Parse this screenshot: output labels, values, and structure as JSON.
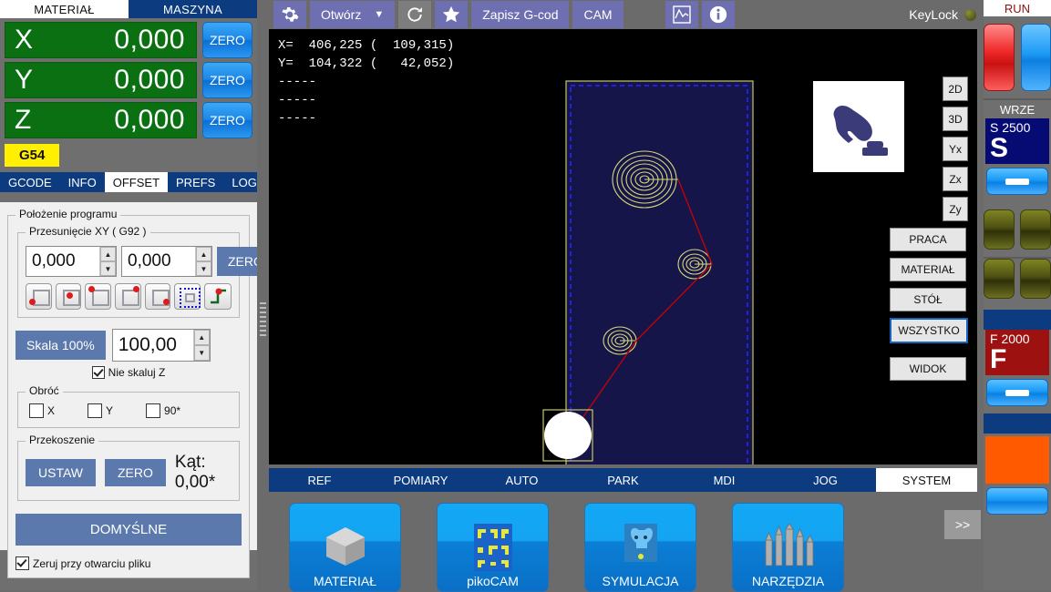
{
  "left": {
    "top_tabs": [
      {
        "label": "MATERIAŁ",
        "active": true
      },
      {
        "label": "MASZYNA",
        "active": false
      }
    ],
    "dro": [
      {
        "axis": "X",
        "value": "0,000",
        "zero_label": "ZERO"
      },
      {
        "axis": "Y",
        "value": "0,000",
        "zero_label": "ZERO"
      },
      {
        "axis": "Z",
        "value": "0,000",
        "zero_label": "ZERO"
      }
    ],
    "wcs": "G54",
    "tabs": [
      {
        "label": "GCODE",
        "active": false
      },
      {
        "label": "INFO",
        "active": false
      },
      {
        "label": "OFFSET",
        "active": true
      },
      {
        "label": "PREFS",
        "active": false
      },
      {
        "label": "LOG",
        "active": false
      }
    ],
    "offset": {
      "group_title": "Położenie programu",
      "xy_group_title": "Przesunięcie XY ( G92 )",
      "x_value": "0,000",
      "y_value": "0,000",
      "zero_label": "ZERO",
      "scale_button": "Skala 100%",
      "scale_value": "100,00",
      "no_scale_z": "Nie skaluj Z",
      "no_scale_z_checked": true,
      "rotate_title": "Obróć",
      "rotate_x": "X",
      "rotate_y": "Y",
      "rotate_90": "90*",
      "skew_title": "Przekoszenie",
      "skew_set": "USTAW",
      "skew_zero": "ZERO",
      "skew_angle": "Kąt: 0,00*",
      "defaults": "DOMYŚLNE",
      "zero_on_open": "Zeruj przy otwarciu pliku",
      "zero_on_open_checked": true
    }
  },
  "toolbar": {
    "settings_icon": "gear-icon",
    "open_label": "Otwórz",
    "open_caret": "▼",
    "reload_icon": "reload-icon",
    "favorite_icon": "star-icon",
    "save_gcode": "Zapisz G-cod",
    "cam": "CAM",
    "chart_icon": "chart-icon",
    "info_icon": "info-icon",
    "keylock": "KeyLock"
  },
  "viewport": {
    "readout": "X=  406,225 (  109,315)\nY=  104,322 (   42,052)\n-----\n-----\n-----",
    "projection_buttons": [
      "2D",
      "3D",
      "Yx",
      "Zx",
      "Zy"
    ],
    "view_buttons": [
      {
        "label": "PRACA",
        "selected": false
      },
      {
        "label": "MATERIAŁ",
        "selected": false
      },
      {
        "label": "STÓŁ",
        "selected": false
      },
      {
        "label": "WSZYSTKO",
        "selected": true
      },
      {
        "label": "WIDOK",
        "selected": false
      }
    ],
    "hand_icon": "hand-pointer-icon"
  },
  "bottom_tabs": [
    {
      "label": "REF",
      "active": false
    },
    {
      "label": "POMIARY",
      "active": false
    },
    {
      "label": "AUTO",
      "active": false
    },
    {
      "label": "PARK",
      "active": false
    },
    {
      "label": "MDI",
      "active": false
    },
    {
      "label": "JOG",
      "active": false
    },
    {
      "label": "SYSTEM",
      "active": true
    }
  ],
  "tiles": [
    {
      "label": "MATERIAŁ",
      "icon": "cube-icon"
    },
    {
      "label": "pikoCAM",
      "icon": "pikocam-icon"
    },
    {
      "label": "SYMULACJA",
      "icon": "dog-icon"
    },
    {
      "label": "NARZĘDZIA",
      "icon": "tools-icon"
    }
  ],
  "more_button": ">>",
  "right": {
    "run_label": "RUN",
    "spindle_label": "WRZE",
    "spindle_value": "S 2500",
    "spindle_big": "S",
    "feed_value": "F 2000",
    "feed_big": "F"
  },
  "colors": {
    "green_dro": "#0a7012",
    "blue_tab": "#0d3b80",
    "accent_purple": "#6e6fb0",
    "yellow_wcs": "#ffef00",
    "estop_red": "#f02b2b",
    "feed_red": "#9e1111",
    "spindle_navy": "#060a73",
    "viewport_bg": "#000000",
    "stock_fill": "#15154a",
    "toolpath_yellow": "#d8d878",
    "rapid_red": "#cc0000"
  }
}
